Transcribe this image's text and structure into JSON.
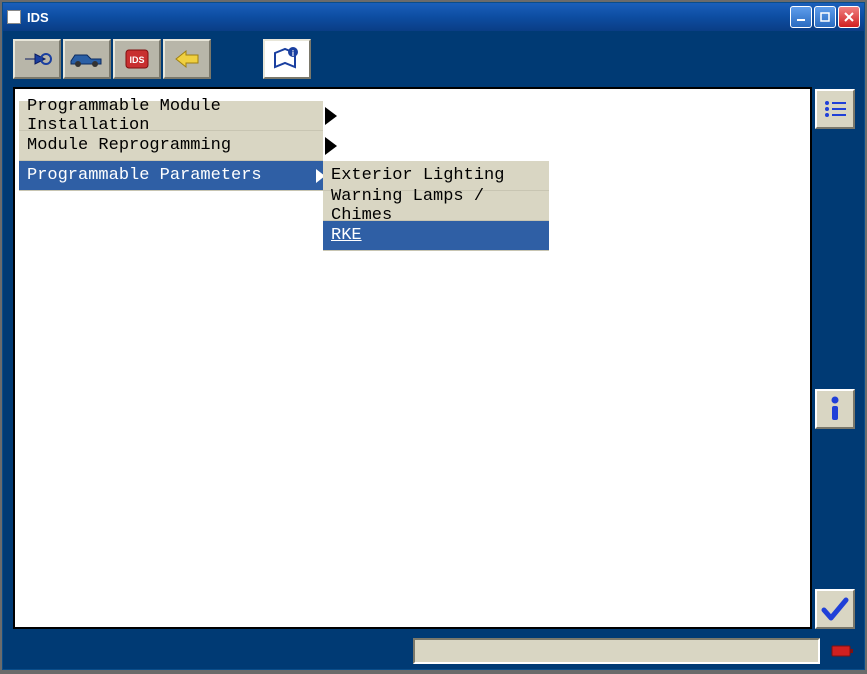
{
  "window": {
    "title": "IDS"
  },
  "toolbar": {
    "icons": [
      "connector",
      "vehicle",
      "diagnostics",
      "yellow-arrow",
      "info-book"
    ]
  },
  "menu": {
    "items": [
      {
        "label": "Programmable Module Installation",
        "hasSub": true,
        "selected": false
      },
      {
        "label": "Module Reprogramming",
        "hasSub": true,
        "selected": false
      },
      {
        "label": "Programmable Parameters",
        "hasSub": true,
        "selected": true
      }
    ]
  },
  "submenu": {
    "items": [
      {
        "label": "Exterior Lighting",
        "selected": false
      },
      {
        "label": "Warning Lamps / Chimes",
        "selected": false
      },
      {
        "label": "RKE",
        "selected": true
      }
    ]
  },
  "sidebar": {
    "list_btn": "list",
    "info_btn": "info",
    "confirm_btn": "ok"
  }
}
